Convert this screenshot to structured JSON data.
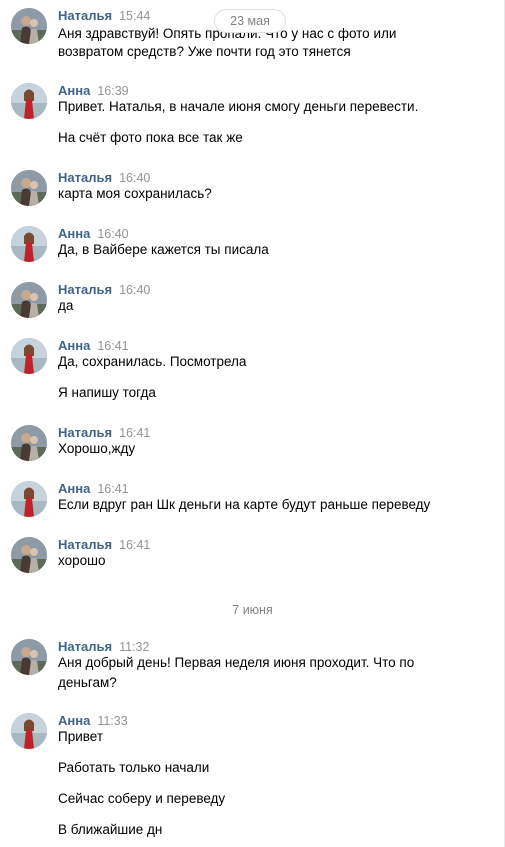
{
  "date_separators": {
    "first": "23 мая",
    "second": "7 июня"
  },
  "messages": [
    {
      "author": "Наталья",
      "time": "15:44",
      "avatar": "avatar-natalya",
      "lines": [
        "Аня здравствуй! Опять пропали. Что у нас с фото или",
        "возвратом средств? Уже почти год это тянется"
      ]
    },
    {
      "author": "Анна",
      "time": "16:39",
      "avatar": "avatar-anna",
      "lines": [
        "Привет. Наталья, в начале июня смогу деньги перевести.",
        "На счёт фото пока все так же"
      ]
    },
    {
      "author": "Наталья",
      "time": "16:40",
      "avatar": "avatar-natalya",
      "lines": [
        "карта моя сохранилась?"
      ]
    },
    {
      "author": "Анна",
      "time": "16:40",
      "avatar": "avatar-anna",
      "lines": [
        "Да, в Вайбере кажется ты писала"
      ]
    },
    {
      "author": "Наталья",
      "time": "16:40",
      "avatar": "avatar-natalya",
      "lines": [
        "да"
      ]
    },
    {
      "author": "Анна",
      "time": "16:41",
      "avatar": "avatar-anna",
      "lines": [
        "Да, сохранилась. Посмотрела",
        "Я напишу тогда"
      ]
    },
    {
      "author": "Наталья",
      "time": "16:41",
      "avatar": "avatar-natalya",
      "lines": [
        "Хорошо,жду"
      ]
    },
    {
      "author": "Анна",
      "time": "16:41",
      "avatar": "avatar-anna",
      "lines": [
        "Если вдруг ран Шк деньги на карте будут раньше переведу"
      ]
    },
    {
      "author": "Наталья",
      "time": "16:41",
      "avatar": "avatar-natalya",
      "lines": [
        "хорошо"
      ]
    },
    {
      "author": "Наталья",
      "time": "11:32",
      "avatar": "avatar-natalya",
      "lines": [
        "Аня добрый день! Первая неделя июня проходит. Что по",
        "деньгам?"
      ]
    },
    {
      "author": "Анна",
      "time": "11:33",
      "avatar": "avatar-anna",
      "lines": [
        "Привет",
        "Работать только начали",
        "Сейчас соберу и переведу",
        "В ближайшие дн"
      ]
    }
  ],
  "colors": {
    "author": "#42648b",
    "time": "#939393",
    "text": "#000000",
    "separator": "#828282"
  }
}
